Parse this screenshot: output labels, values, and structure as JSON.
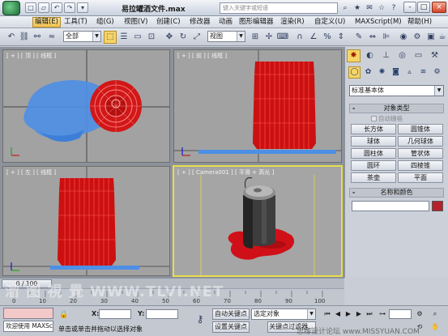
{
  "window": {
    "title": "易拉罐酒文件.max",
    "search_placeholder": "键入关键字或短语",
    "accent_color": "#f6d467",
    "buttons": [
      "-",
      "□",
      "×"
    ]
  },
  "quick_access": [
    "□",
    "▱",
    "↶",
    "↷",
    "▾"
  ],
  "menu": {
    "items": [
      "编辑(E)",
      "工具(T)",
      "组(G)",
      "视图(V)",
      "创建(C)",
      "修改器",
      "动画",
      "图形编辑器",
      "渲染(R)",
      "自定义(U)",
      "MAXScript(M)",
      "帮助(H)"
    ]
  },
  "toolbar": {
    "selection_filter": "全部",
    "reference_coord": "视图"
  },
  "viewports": [
    {
      "label": "[ + ] [ 顶 ] [ 线框 ]",
      "name": "top"
    },
    {
      "label": "[ + ] [ 前 ] [ 线框 ]",
      "name": "front"
    },
    {
      "label": "[ + ] [ 左 ] [ 线框 ]",
      "name": "left"
    },
    {
      "label": "[ + ] [ Camera001 ] [ 平滑 + 高光 ]",
      "name": "camera"
    }
  ],
  "command_panel": {
    "category": "标准基本体",
    "object_type_title": "对象类型",
    "autogrid": "自动栅格",
    "objects": [
      "长方体",
      "圆锥体",
      "球体",
      "几何球体",
      "圆柱体",
      "管状体",
      "圆环",
      "四棱锥",
      "茶壶",
      "平面"
    ],
    "name_color_title": "名称和颜色",
    "object_color": "#b5202a"
  },
  "timeline": {
    "frame": "0 / 100",
    "ticks": [
      "0",
      "10",
      "20",
      "30",
      "40",
      "50",
      "60",
      "70",
      "80",
      "90",
      "100"
    ]
  },
  "status": {
    "welcome": "欢迎使用 MAXSc",
    "prompt": "单击或单击并拖动以选择对象",
    "x_label": "X:",
    "y_label": "Y:",
    "auto_key": "自动关键点",
    "set_key": "设置关键点",
    "selected_object": "选定对象",
    "key_filters": "关键点过滤器..."
  },
  "watermarks": {
    "left": "溜 图 視 覺 WWW.TLVI.NET",
    "right": "思缘设计论坛 www.MISSYUAN.COM"
  }
}
